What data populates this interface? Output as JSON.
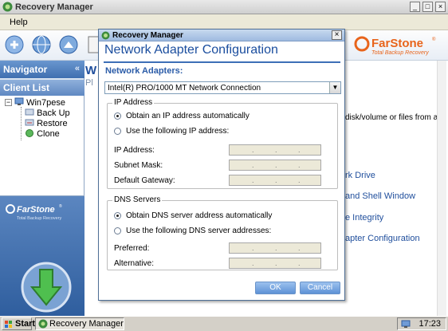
{
  "window": {
    "title": "Recovery Manager",
    "controls": {
      "minimize": "_",
      "maximize": "□",
      "close": "×"
    }
  },
  "menu": {
    "help": "Help"
  },
  "brand": {
    "name": "FarStone",
    "registered": "®",
    "tagline": "Total Backup Recovery"
  },
  "navigator": {
    "header": "Navigator",
    "collapse_glyph": "«",
    "client_list_header": "Client List",
    "tree": {
      "root": "Win7pese",
      "expander": "−",
      "children": [
        "Back Up",
        "Restore",
        "Clone"
      ]
    },
    "bottom_brand": {
      "name": "FarStone",
      "registered": "®",
      "tagline": "Total Backup Recovery"
    }
  },
  "main_fragments": {
    "heading_w": "W",
    "pl": "Pl",
    "disk_text": "disk/volume or files from a",
    "link1": "rk Drive",
    "link2": "and Shell Window",
    "link3": "e Integrity",
    "link4": "apter Configuration"
  },
  "dialog": {
    "title": "Recovery Manager",
    "close": "×",
    "heading": "Network Adapter Configuration",
    "adapters_label": "Network Adapters:",
    "adapter_selected": "Intel(R) PRO/1000 MT Network Connection",
    "ip_group": {
      "title": "IP Address",
      "opt_auto": "Obtain an IP address automatically",
      "opt_manual": "Use the following IP address:",
      "selected": "auto",
      "fields": [
        "IP Address:",
        "Subnet Mask:",
        "Default Gateway:"
      ]
    },
    "dns_group": {
      "title": "DNS Servers",
      "opt_auto": "Obtain DNS server address automatically",
      "opt_manual": "Use the following DNS server addresses:",
      "selected": "auto",
      "fields": [
        "Preferred:",
        "Alternative:"
      ]
    },
    "ok": "OK",
    "cancel": "Cancel"
  },
  "taskbar": {
    "start": "Start",
    "task": "Recovery Manager",
    "clock": "17:23"
  },
  "colors": {
    "accent": "#1a4d9e",
    "farstone_orange": "#e8641b",
    "nav_blue": "#3f6fb0"
  }
}
